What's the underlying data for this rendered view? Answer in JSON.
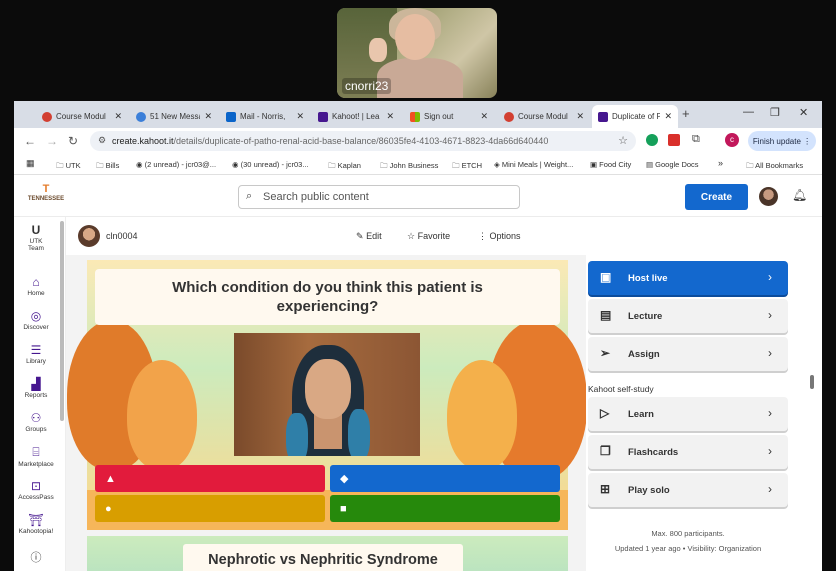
{
  "video": {
    "participant_name": "cnorri23"
  },
  "browser": {
    "tabs": [
      {
        "label": "Course Modul",
        "color": "#d23f31"
      },
      {
        "label": "51 New Messa",
        "color": "#3b7fd9"
      },
      {
        "label": "Mail - Norris,",
        "color": "#0a64c9"
      },
      {
        "label": "Kahoot! | Lea",
        "color": "#46178f"
      },
      {
        "label": "Sign out",
        "color": "#f25022"
      },
      {
        "label": "Course Modul",
        "color": "#d23f31"
      },
      {
        "label": "Duplicate of P",
        "color": "#46178f"
      }
    ],
    "url_site": "create.kahoot.it",
    "url_path": "/details/duplicate-of-patho-renal-acid-base-balance/86035fe4-4103-4671-8823-4da66d640440",
    "update_label": "Finish update",
    "bookmarks": [
      "UTK",
      "Bills",
      "(2 unread) - jcr03@...",
      "(30 unread) - jcr03...",
      "Kaplan",
      "John Business",
      "ETCH",
      "Mini Meals | Weight...",
      "Food City",
      "Google Docs",
      "All Bookmarks"
    ]
  },
  "kahoot": {
    "logo_text": "TENNESSEE",
    "search_placeholder": "Search public content",
    "create_label": "Create",
    "sidebar": [
      {
        "label": "UTK",
        "sub": "Team",
        "icon": "team-icon"
      },
      {
        "label": "Home",
        "icon": "home-icon"
      },
      {
        "label": "Discover",
        "icon": "compass-icon"
      },
      {
        "label": "Library",
        "icon": "library-icon"
      },
      {
        "label": "Reports",
        "icon": "reports-icon"
      },
      {
        "label": "Groups",
        "icon": "groups-icon"
      },
      {
        "label": "Marketplace",
        "icon": "marketplace-icon"
      },
      {
        "label": "AccessPass",
        "icon": "accesspass-icon"
      },
      {
        "label": "Kahootopia!",
        "icon": "kahootopia-icon"
      }
    ],
    "owner": "cln0004",
    "actions": {
      "edit": "Edit",
      "favorite": "Favorite",
      "options": "Options"
    },
    "question": "Which condition do you think this patient is experiencing?",
    "next_slide_title": "Nephrotic vs Nephritic Syndrome",
    "answer_colors": [
      "#e21b3c",
      "#1368ce",
      "#d89e00",
      "#26890c"
    ],
    "panel": {
      "host_live": "Host live",
      "lecture": "Lecture",
      "assign": "Assign",
      "self_study_heading": "Kahoot self-study",
      "learn": "Learn",
      "flashcards": "Flashcards",
      "play_solo": "Play solo",
      "max_participants": "Max. 800 participants.",
      "updated": "Updated 1 year ago • Visibility: Organization"
    }
  }
}
